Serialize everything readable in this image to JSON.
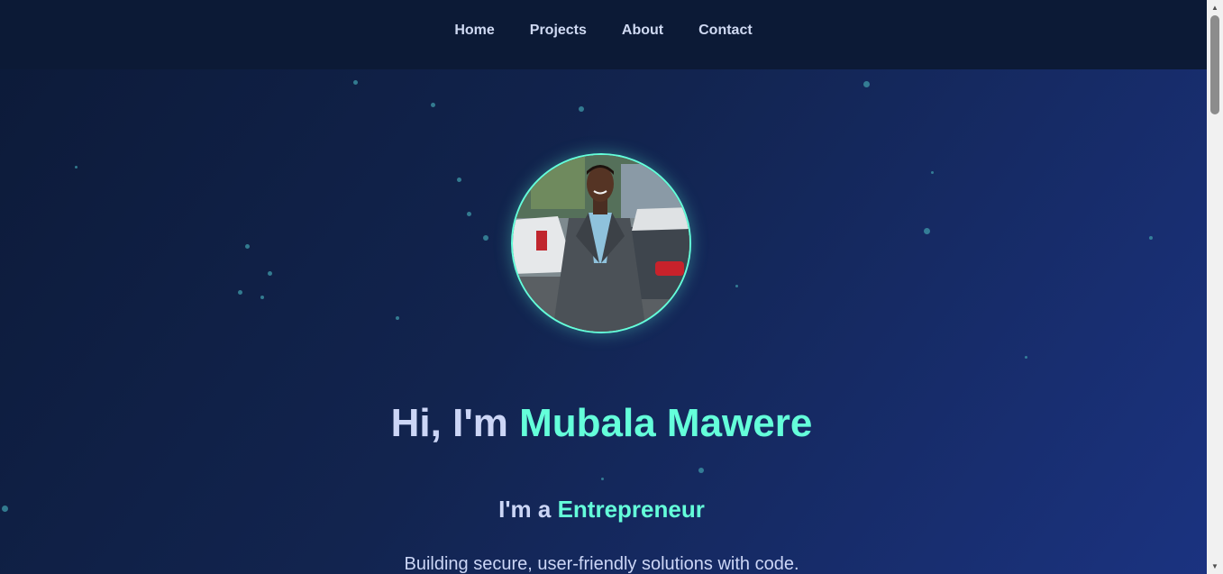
{
  "nav": {
    "items": [
      {
        "label": "Home"
      },
      {
        "label": "Projects"
      },
      {
        "label": "About"
      },
      {
        "label": "Contact"
      }
    ]
  },
  "hero": {
    "greeting": "Hi, I'm ",
    "name": "Mubala Mawere",
    "role_prefix": "I'm a ",
    "role": "Entrepreneur",
    "tagline": "Building secure, user-friendly solutions with code."
  },
  "colors": {
    "accent": "#64ffda",
    "text": "#ccd6f6",
    "nav_background": "#0c1a36",
    "background_start": "#0c1a38",
    "background_end": "#1b3381"
  },
  "icons": {
    "scroll_up": "▲",
    "scroll_down": "▼"
  }
}
